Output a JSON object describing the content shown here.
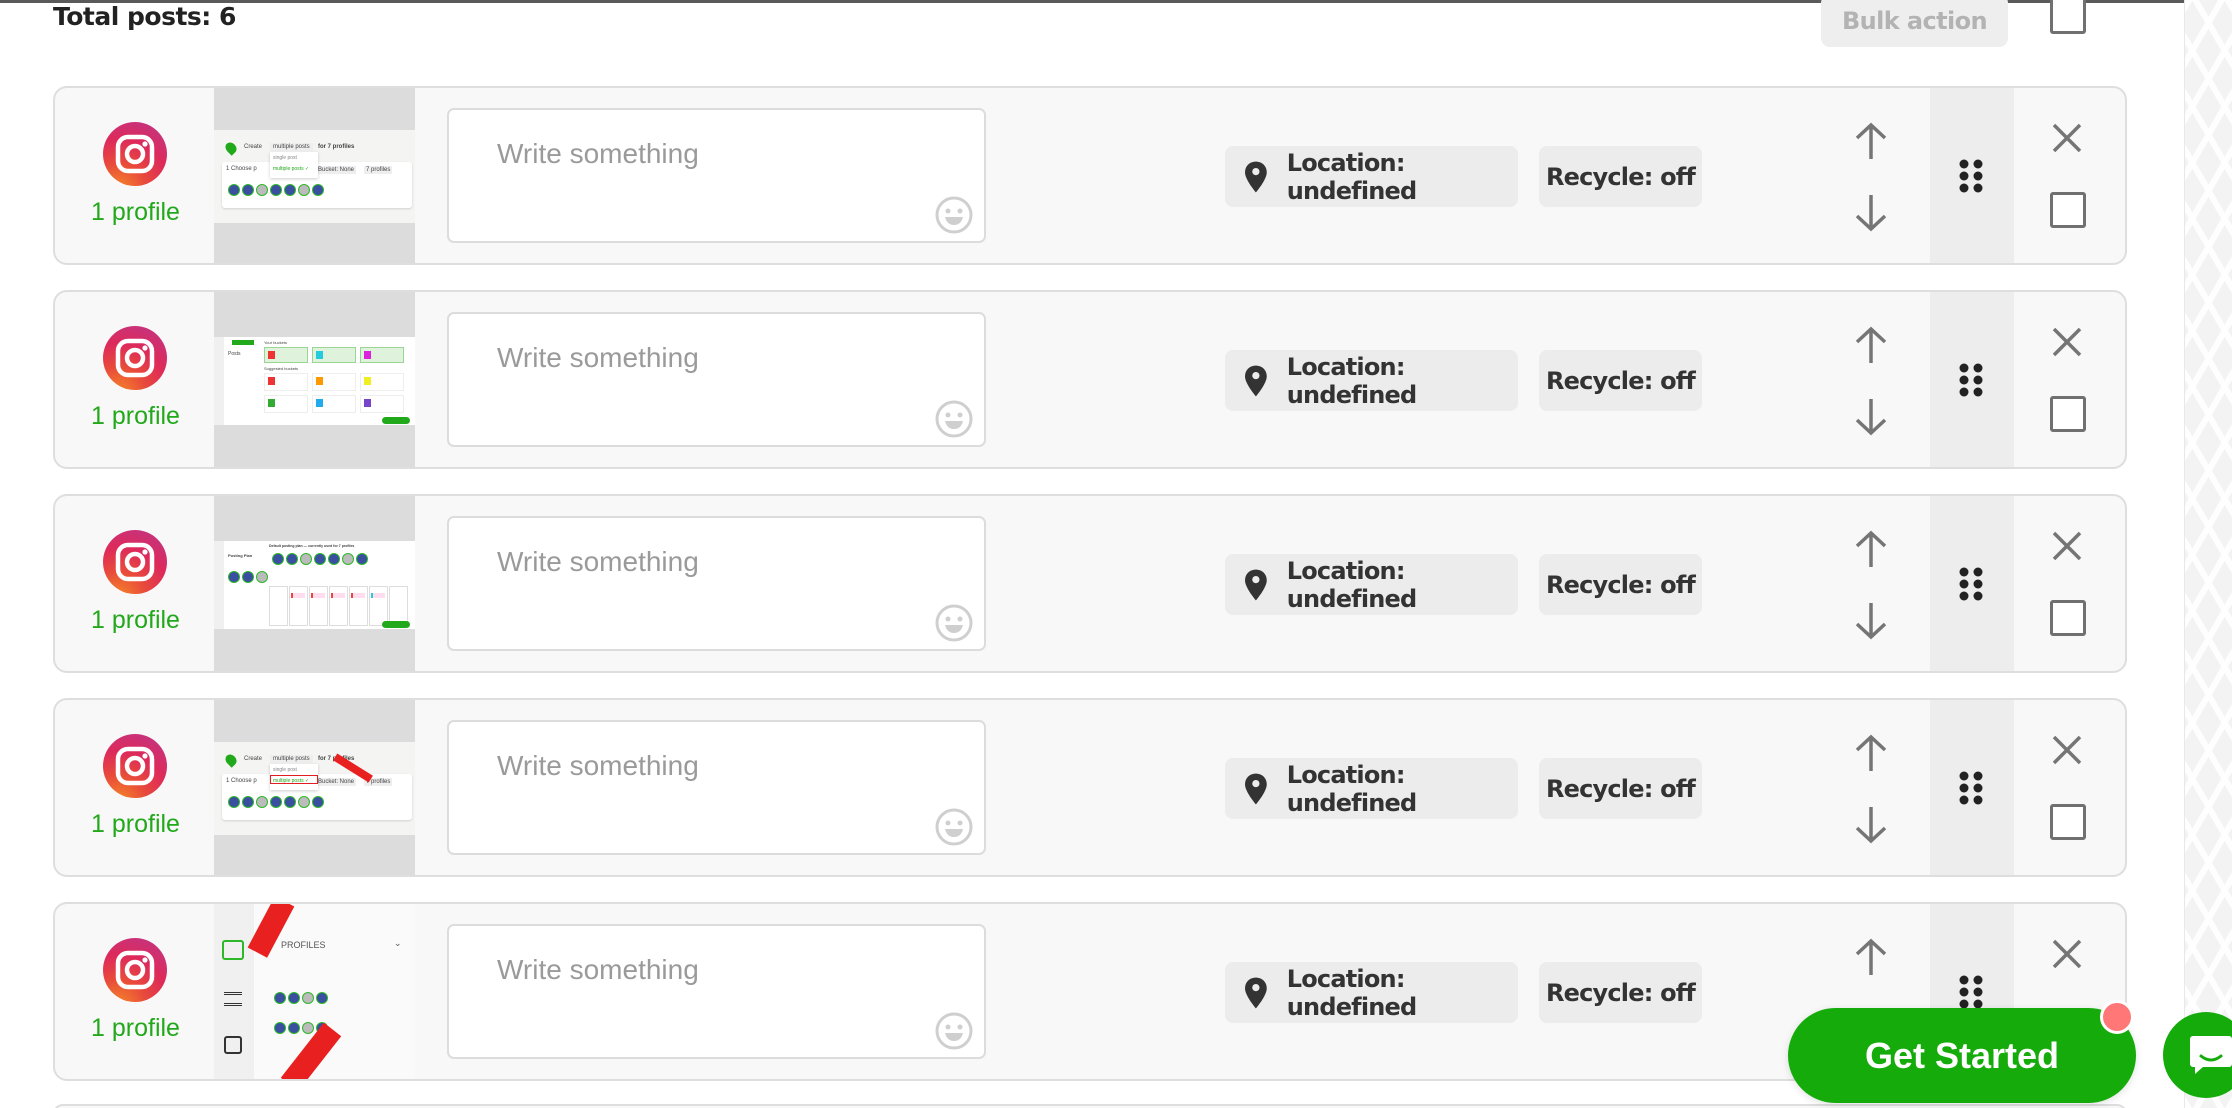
{
  "header": {
    "total_posts_label": "Total posts: 6",
    "bulk_action_label": "Bulk action"
  },
  "colors": {
    "accent_green": "#15ac0b",
    "profile_green": "#22a91b",
    "notification_red": "#ff7777"
  },
  "posts": [
    {
      "platform_icon": "instagram-icon",
      "profile_count": "1 profile",
      "thumbnail": "screenshot-create-multiple-posts",
      "text_placeholder": "Write something",
      "location_label": "Location: undefined",
      "recycle_label": "Recycle: off"
    },
    {
      "platform_icon": "instagram-icon",
      "profile_count": "1 profile",
      "thumbnail": "screenshot-buckets-page",
      "text_placeholder": "Write something",
      "location_label": "Location: undefined",
      "recycle_label": "Recycle: off"
    },
    {
      "platform_icon": "instagram-icon",
      "profile_count": "1 profile",
      "thumbnail": "screenshot-posting-plan",
      "text_placeholder": "Write something",
      "location_label": "Location: undefined",
      "recycle_label": "Recycle: off"
    },
    {
      "platform_icon": "instagram-icon",
      "profile_count": "1 profile",
      "thumbnail": "screenshot-create-multiple-posts-annotated",
      "text_placeholder": "Write something",
      "location_label": "Location: undefined",
      "recycle_label": "Recycle: off"
    },
    {
      "platform_icon": "instagram-icon",
      "profile_count": "1 profile",
      "thumbnail": "screenshot-profiles-picker-annotated",
      "text_placeholder": "Write something",
      "location_label": "Location: undefined",
      "recycle_label": "Recycle: off"
    }
  ],
  "thumbnails": {
    "create": {
      "create_label": "Create",
      "dropdown_value": "multiple posts",
      "for_profiles": "for 7 profiles",
      "option_single": "single post",
      "option_multiple": "multiple posts ✓",
      "step_label": "1  Choose p",
      "bucket_label": "Bucket: None",
      "profiles_label": "7 profiles"
    },
    "buckets": {
      "new_post": "Create Post",
      "your_buckets": "Your buckets",
      "suggested": "Suggested buckets",
      "posts": "Posts"
    },
    "plan": {
      "title": "Posting Plan",
      "heading": "Default posting plan — currently used for 7 profiles"
    },
    "profiles": {
      "section_label": "PROFILES"
    }
  },
  "floating": {
    "get_started_label": "Get Started",
    "chat_icon": "chat-icon"
  }
}
